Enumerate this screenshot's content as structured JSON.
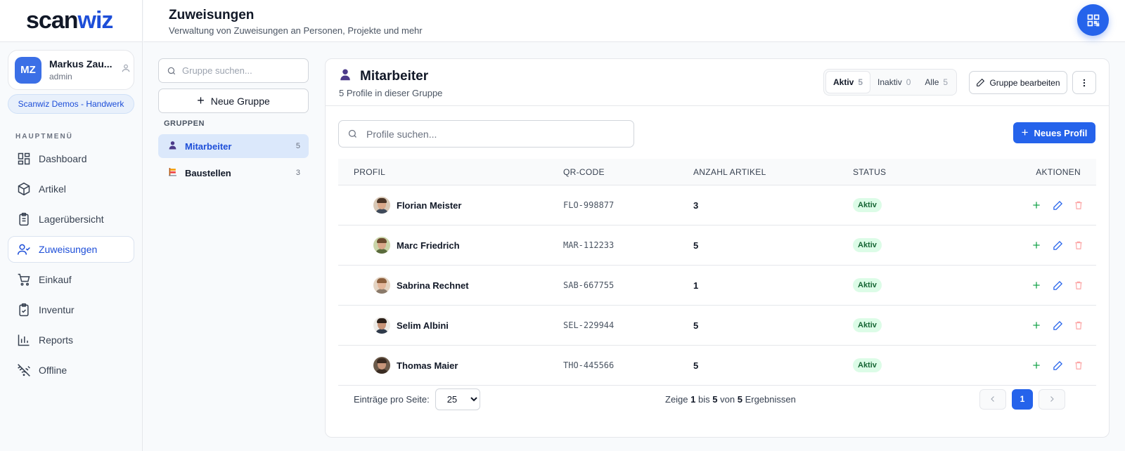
{
  "brand": {
    "logo_part1": "scan",
    "logo_part2": "wiz"
  },
  "user": {
    "initials": "MZ",
    "name": "Markus Zau...",
    "role": "admin",
    "org": "Scanwiz Demos - Handwerk"
  },
  "menu": {
    "heading": "HAUPTMENÜ",
    "items": [
      {
        "label": "Dashboard",
        "icon": "dashboard-icon"
      },
      {
        "label": "Artikel",
        "icon": "box-icon"
      },
      {
        "label": "Lagerübersicht",
        "icon": "clipboard-icon"
      },
      {
        "label": "Zuweisungen",
        "icon": "user-check-icon",
        "active": true
      },
      {
        "label": "Einkauf",
        "icon": "cart-icon"
      },
      {
        "label": "Inventur",
        "icon": "clipboard-check-icon"
      },
      {
        "label": "Reports",
        "icon": "bar-chart-icon"
      },
      {
        "label": "Offline",
        "icon": "wifi-off-icon"
      }
    ]
  },
  "header": {
    "title": "Zuweisungen",
    "subtitle": "Verwaltung von Zuweisungen an Personen, Projekte und mehr"
  },
  "groups": {
    "search_placeholder": "Gruppe suchen...",
    "new_group_label": "Neue Gruppe",
    "heading": "GRUPPEN",
    "items": [
      {
        "label": "Mitarbeiter",
        "count": "5",
        "icon": "person-icon"
      },
      {
        "label": "Baustellen",
        "count": "3",
        "icon": "construction-icon"
      }
    ]
  },
  "panel": {
    "title": "Mitarbeiter",
    "subtitle": "5 Profile in dieser Gruppe",
    "filters": [
      {
        "label": "Aktiv",
        "count": "5"
      },
      {
        "label": "Inaktiv",
        "count": "0"
      },
      {
        "label": "Alle",
        "count": "5"
      }
    ],
    "edit_group_label": "Gruppe bearbeiten",
    "search_placeholder": "Profile suchen...",
    "new_profile_label": "Neues Profil"
  },
  "table": {
    "columns": [
      "PROFIL",
      "QR-CODE",
      "ANZAHL ARTIKEL",
      "STATUS",
      "AKTIONEN"
    ],
    "rows": [
      {
        "name": "Florian Meister",
        "qr": "FLO-998877",
        "count": "3",
        "status": "Aktiv"
      },
      {
        "name": "Marc Friedrich",
        "qr": "MAR-112233",
        "count": "5",
        "status": "Aktiv"
      },
      {
        "name": "Sabrina Rechnet",
        "qr": "SAB-667755",
        "count": "1",
        "status": "Aktiv"
      },
      {
        "name": "Selim Albini",
        "qr": "SEL-229944",
        "count": "5",
        "status": "Aktiv"
      },
      {
        "name": "Thomas Maier",
        "qr": "THO-445566",
        "count": "5",
        "status": "Aktiv"
      }
    ]
  },
  "footer": {
    "per_page_label": "Einträge pro Seite:",
    "per_page_value": "25",
    "results_prefix": "Zeige",
    "results_from": "1",
    "results_mid1": "bis",
    "results_to": "5",
    "results_mid2": "von",
    "results_total": "5",
    "results_suffix": "Ergebnissen",
    "current_page": "1"
  },
  "colors": {
    "accent": "#2563eb",
    "status_active_bg": "#dcfce7",
    "status_active_fg": "#166534"
  }
}
